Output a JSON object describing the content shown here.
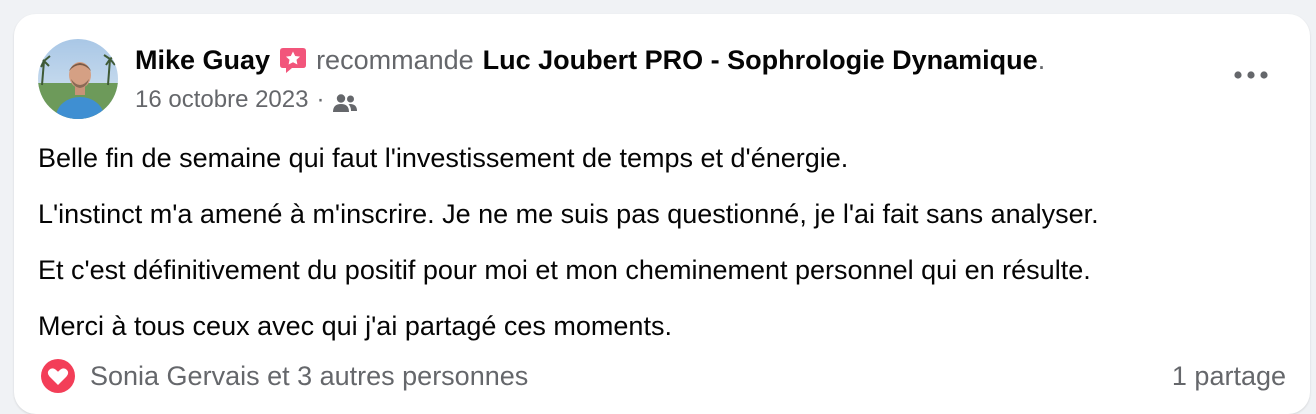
{
  "post": {
    "author": "Mike Guay",
    "badge_icon": "recommend-star-icon",
    "verb": "recommande",
    "page_name": "Luc Joubert PRO - Sophrologie Dynamique",
    "trailing_dot": ".",
    "date": "16 octobre 2023",
    "separator": "·",
    "audience_icon": "friends-icon",
    "more_icon": "more-options-icon",
    "paragraphs": [
      "Belle fin de semaine qui faut l'investissement de temps et d'énergie.",
      "L'instinct m'a amené à m'inscrire. Je ne me suis pas questionné, je l'ai fait sans analyser.",
      "Et c'est définitivement du positif pour moi et mon cheminement personnel qui en résulte.",
      "Merci à tous ceux avec qui j'ai partagé ces moments."
    ]
  },
  "footer": {
    "reaction_icon": "love-reaction-icon",
    "reactors": "Sonia Gervais et 3 autres personnes",
    "shares": "1 partage"
  },
  "colors": {
    "background": "#f0f2f5",
    "card": "#ffffff",
    "primary_text": "#050505",
    "secondary_text": "#65676b",
    "badge": "#f2557b",
    "love": "#f33e58"
  }
}
